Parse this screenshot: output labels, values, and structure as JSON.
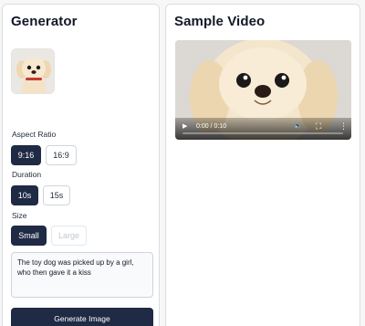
{
  "generator": {
    "title": "Generator",
    "aspect_ratio": {
      "label": "Aspect Ratio",
      "options": [
        "9:16",
        "16:9"
      ],
      "selected": "9:16"
    },
    "duration": {
      "label": "Duration",
      "options": [
        "10s",
        "15s"
      ],
      "selected": "10s"
    },
    "size": {
      "label": "Size",
      "options": [
        "Small",
        "Large"
      ],
      "selected": "Small",
      "disabled": [
        "Large"
      ]
    },
    "prompt": {
      "value": "The toy dog was picked up by a girl, who then gave it a kiss"
    },
    "generate_button": "Generate Image"
  },
  "sample": {
    "title": "Sample Video",
    "player": {
      "time": "0:00 / 0:10",
      "progress": 0.0
    },
    "icons": [
      "play-icon",
      "volume-icon",
      "fullscreen-icon",
      "more-options-icon"
    ]
  },
  "colors": {
    "primary": "#1f2a44",
    "border": "#d1d5db",
    "panel": "#ffffff",
    "background": "#f7f7f8"
  }
}
